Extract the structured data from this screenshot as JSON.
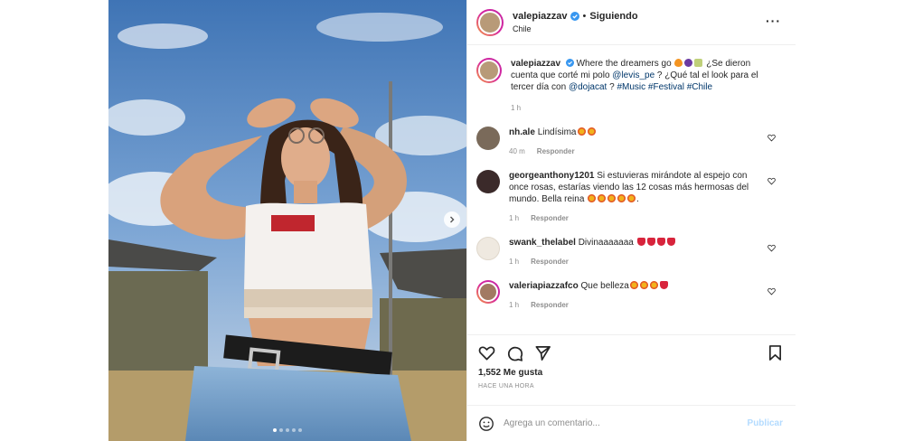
{
  "post": {
    "username": "valepiazzav",
    "separator": "•",
    "follow_status": "Siguiendo",
    "location": "Chile",
    "more_label": "···",
    "carousel_index": 1,
    "carousel_count": 5
  },
  "caption": {
    "username": "valepiazzav",
    "text_1": "Where the dreamers go",
    "text_2": "¿Se dieron cuenta que corté mi polo",
    "mention_1": "@levis_pe",
    "text_3": "? ¿Qué tal el look para el tercer día con",
    "mention_2": "@dojacat",
    "text_4": "?",
    "hashtags": "#Music #Festival #Chile",
    "time": "1 h"
  },
  "comments": [
    {
      "username": "nh.ale",
      "text": "Lindísima",
      "time": "40 m",
      "reply": "Responder",
      "avatar_color": "#7a6a5a"
    },
    {
      "username": "georgeanthony1201",
      "text": "Si estuvieras mirándote al espejo con once rosas, estarías viendo las 12 cosas más hermosas del mundo. Bella reina",
      "time": "1 h",
      "reply": "Responder",
      "avatar_color": "#3b2a2a"
    },
    {
      "username": "swank_thelabel",
      "text": "Divinaaaaaaa",
      "time": "1 h",
      "reply": "Responder",
      "avatar_color": "#efe9e0"
    },
    {
      "username": "valeriapiazzafco",
      "text": "Que belleza",
      "time": "1 h",
      "reply": "Responder",
      "avatar_color": "#a27a63"
    }
  ],
  "actions": {
    "likes": "1,552 Me gusta",
    "time_ago": "HACE UNA HORA"
  },
  "add_comment": {
    "placeholder": "Agrega un comentario...",
    "publish": "Publicar"
  },
  "icons": [
    "verified-badge-icon",
    "more-options-icon",
    "heart-icon",
    "comment-icon",
    "share-icon",
    "bookmark-icon",
    "emoji-icon",
    "chevron-right-icon"
  ],
  "colors": {
    "link": "#00376b",
    "muted": "#8e8e8e",
    "publish_disabled": "#b3dbff",
    "verified": "#3897f0"
  }
}
